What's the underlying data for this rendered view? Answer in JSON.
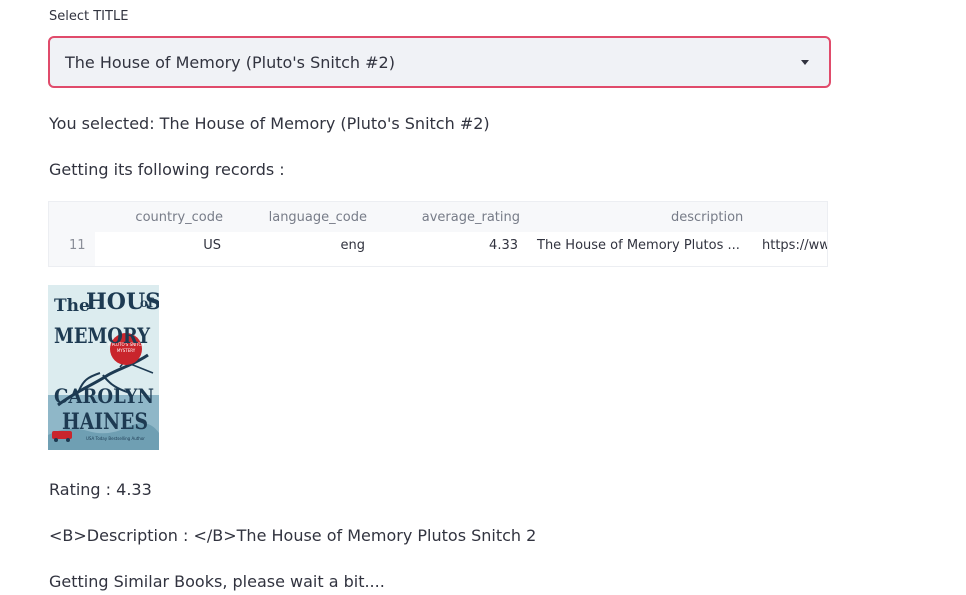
{
  "select": {
    "label": "Select TITLE",
    "value": "The House of Memory (Pluto's Snitch #2)"
  },
  "selected_text": "You selected: The House of Memory (Pluto's Snitch #2)",
  "records_heading": "Getting its following records :",
  "table": {
    "columns": [
      "country_code",
      "language_code",
      "average_rating",
      "description"
    ],
    "rows": [
      {
        "index": "11",
        "country_code": "US",
        "language_code": "eng",
        "average_rating": "4.33",
        "description": "The House of Memory Plutos ...",
        "link": "https://ww"
      }
    ]
  },
  "cover": {
    "title_word_1": "The",
    "title_word_2": "HOUSE",
    "title_word_3": "of",
    "title_word_4": "MEMORY",
    "badge": "A PLUTO'S SNITCH MYSTERY",
    "author_1": "CAROLYN",
    "author_2": "HAINES",
    "tagline": "USA Today Bestselling Author",
    "colors": {
      "sky": "#dcecef",
      "water": "#8fb7c8",
      "title": "#1d3a52",
      "badge": "#c9252c"
    }
  },
  "rating_text": "Rating : 4.33",
  "description_text": "<B>Description : </B>The House of Memory Plutos Snitch 2",
  "similar_text": "Getting Similar Books, please wait a bit...."
}
